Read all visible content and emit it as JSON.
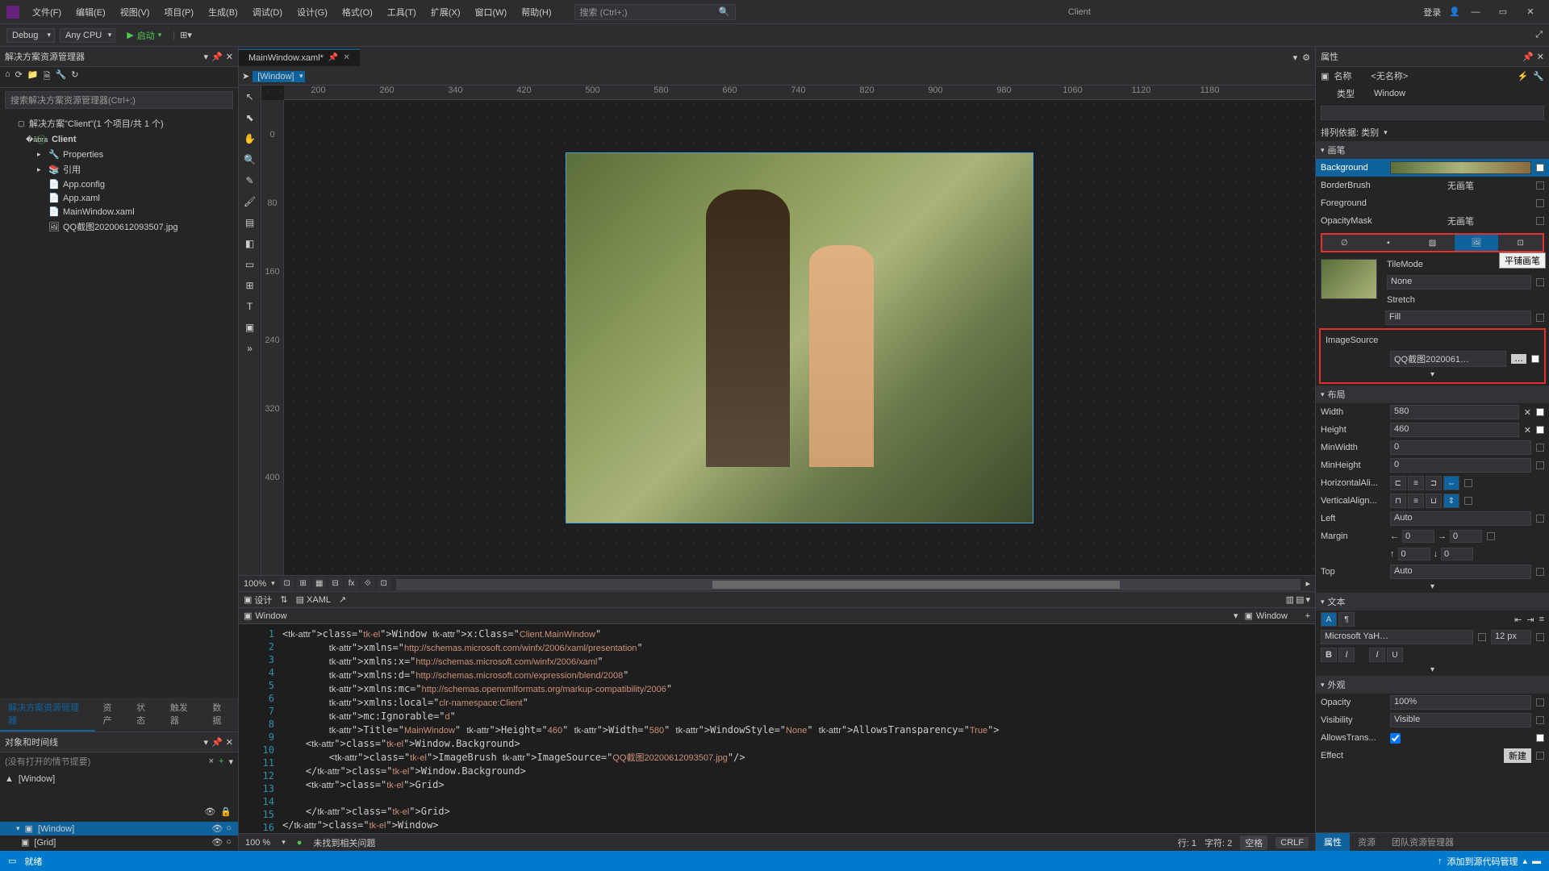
{
  "titlebar": {
    "menus": [
      "文件(F)",
      "编辑(E)",
      "视图(V)",
      "项目(P)",
      "生成(B)",
      "调试(D)",
      "设计(G)",
      "格式(O)",
      "工具(T)",
      "扩展(X)",
      "窗口(W)",
      "帮助(H)"
    ],
    "search_placeholder": "搜索 (Ctrl+;)",
    "app_title": "Client",
    "login": "登录"
  },
  "toolbar": {
    "config": "Debug",
    "platform": "Any CPU",
    "start": "启动"
  },
  "solution": {
    "title": "解决方案资源管理器",
    "search_placeholder": "搜索解决方案资源管理器(Ctrl+;)",
    "root": "解决方案\"Client\"(1 个项目/共 1 个)",
    "project": "Client",
    "items": [
      "Properties",
      "引用",
      "App.config",
      "App.xaml",
      "MainWindow.xaml",
      "QQ截图20200612093507.jpg"
    ],
    "bottom_tabs": [
      "解决方案资源管理器",
      "资产",
      "状态",
      "触发器",
      "数据"
    ]
  },
  "timeline": {
    "title": "对象和时间线",
    "placeholder": "(没有打开的情节提要)",
    "root": "[Window]",
    "items": [
      {
        "name": "[Window]",
        "sel": true
      },
      {
        "name": "[Grid]",
        "sel": false
      }
    ]
  },
  "document": {
    "tab": "MainWindow.xaml*",
    "element": "[Window]",
    "ruler_h": [
      "200",
      "260",
      "340",
      "420",
      "500",
      "580",
      "660",
      "740",
      "820",
      "900",
      "980",
      "1060",
      "1120",
      "1180"
    ],
    "ruler_v": [
      "0",
      "80",
      "160",
      "240",
      "320",
      "400"
    ],
    "zoom": "100%",
    "split": {
      "design": "设计",
      "xaml": "XAML"
    },
    "breadcrumb": "Window",
    "code_zoom": "100 %",
    "no_issues": "未找到相关问题",
    "status": {
      "line": "行: 1",
      "col": "字符: 2",
      "spaces": "空格",
      "crlf": "CRLF"
    }
  },
  "code": {
    "lines": [
      "<Window x:Class=\"Client.MainWindow\"",
      "        xmlns=\"http://schemas.microsoft.com/winfx/2006/xaml/presentation\"",
      "        xmlns:x=\"http://schemas.microsoft.com/winfx/2006/xaml\"",
      "        xmlns:d=\"http://schemas.microsoft.com/expression/blend/2008\"",
      "        xmlns:mc=\"http://schemas.openxmlformats.org/markup-compatibility/2006\"",
      "        xmlns:local=\"clr-namespace:Client\"",
      "        mc:Ignorable=\"d\"",
      "        Title=\"MainWindow\" Height=\"460\" Width=\"580\" WindowStyle=\"None\" AllowsTransparency=\"True\">",
      "    <Window.Background>",
      "        <ImageBrush ImageSource=\"QQ截图20200612093507.jpg\"/>",
      "    </Window.Background>",
      "    <Grid>",
      "",
      "    </Grid>",
      "</Window>",
      ""
    ]
  },
  "properties": {
    "title": "属性",
    "name_lbl": "名称",
    "name_val": "<无名称>",
    "type_lbl": "类型",
    "type_val": "Window",
    "sort": "排列依据: 类别",
    "groups": {
      "brush": "画笔",
      "layout": "布局",
      "text": "文本",
      "appearance": "外观"
    },
    "brush_rows": [
      {
        "lbl": "Background",
        "val": "",
        "sel": true,
        "swatch": true
      },
      {
        "lbl": "BorderBrush",
        "val": "无画笔"
      },
      {
        "lbl": "Foreground",
        "val": ""
      },
      {
        "lbl": "OpacityMask",
        "val": "无画笔"
      }
    ],
    "tile": {
      "TileMode": "None",
      "Stretch": "Fill",
      "ImageSource": "QQ截图2020061…"
    },
    "tooltip": "平铺画笔",
    "layout": {
      "Width": "580",
      "Height": "460",
      "MinWidth": "0",
      "MinHeight": "0",
      "HorizontalAlignment": "HorizontalAli...",
      "VerticalAlignment": "VerticalAlign...",
      "Left": "Auto",
      "Margin_l": "0",
      "Margin_r": "0",
      "Margin_t": "0",
      "Margin_b": "0",
      "Top": "Auto"
    },
    "text": {
      "font": "Microsoft YaH…",
      "size": "12 px"
    },
    "appearance": {
      "Opacity": "100%",
      "Visibility": "Visible",
      "AllowsTrans": "AllowsTrans...",
      "Effect": "",
      "effect_btn": "新建"
    },
    "bottom_tabs": [
      "属性",
      "资源",
      "团队资源管理器"
    ]
  },
  "statusbar": {
    "ready": "就绪",
    "add_source": "添加到源代码管理"
  }
}
